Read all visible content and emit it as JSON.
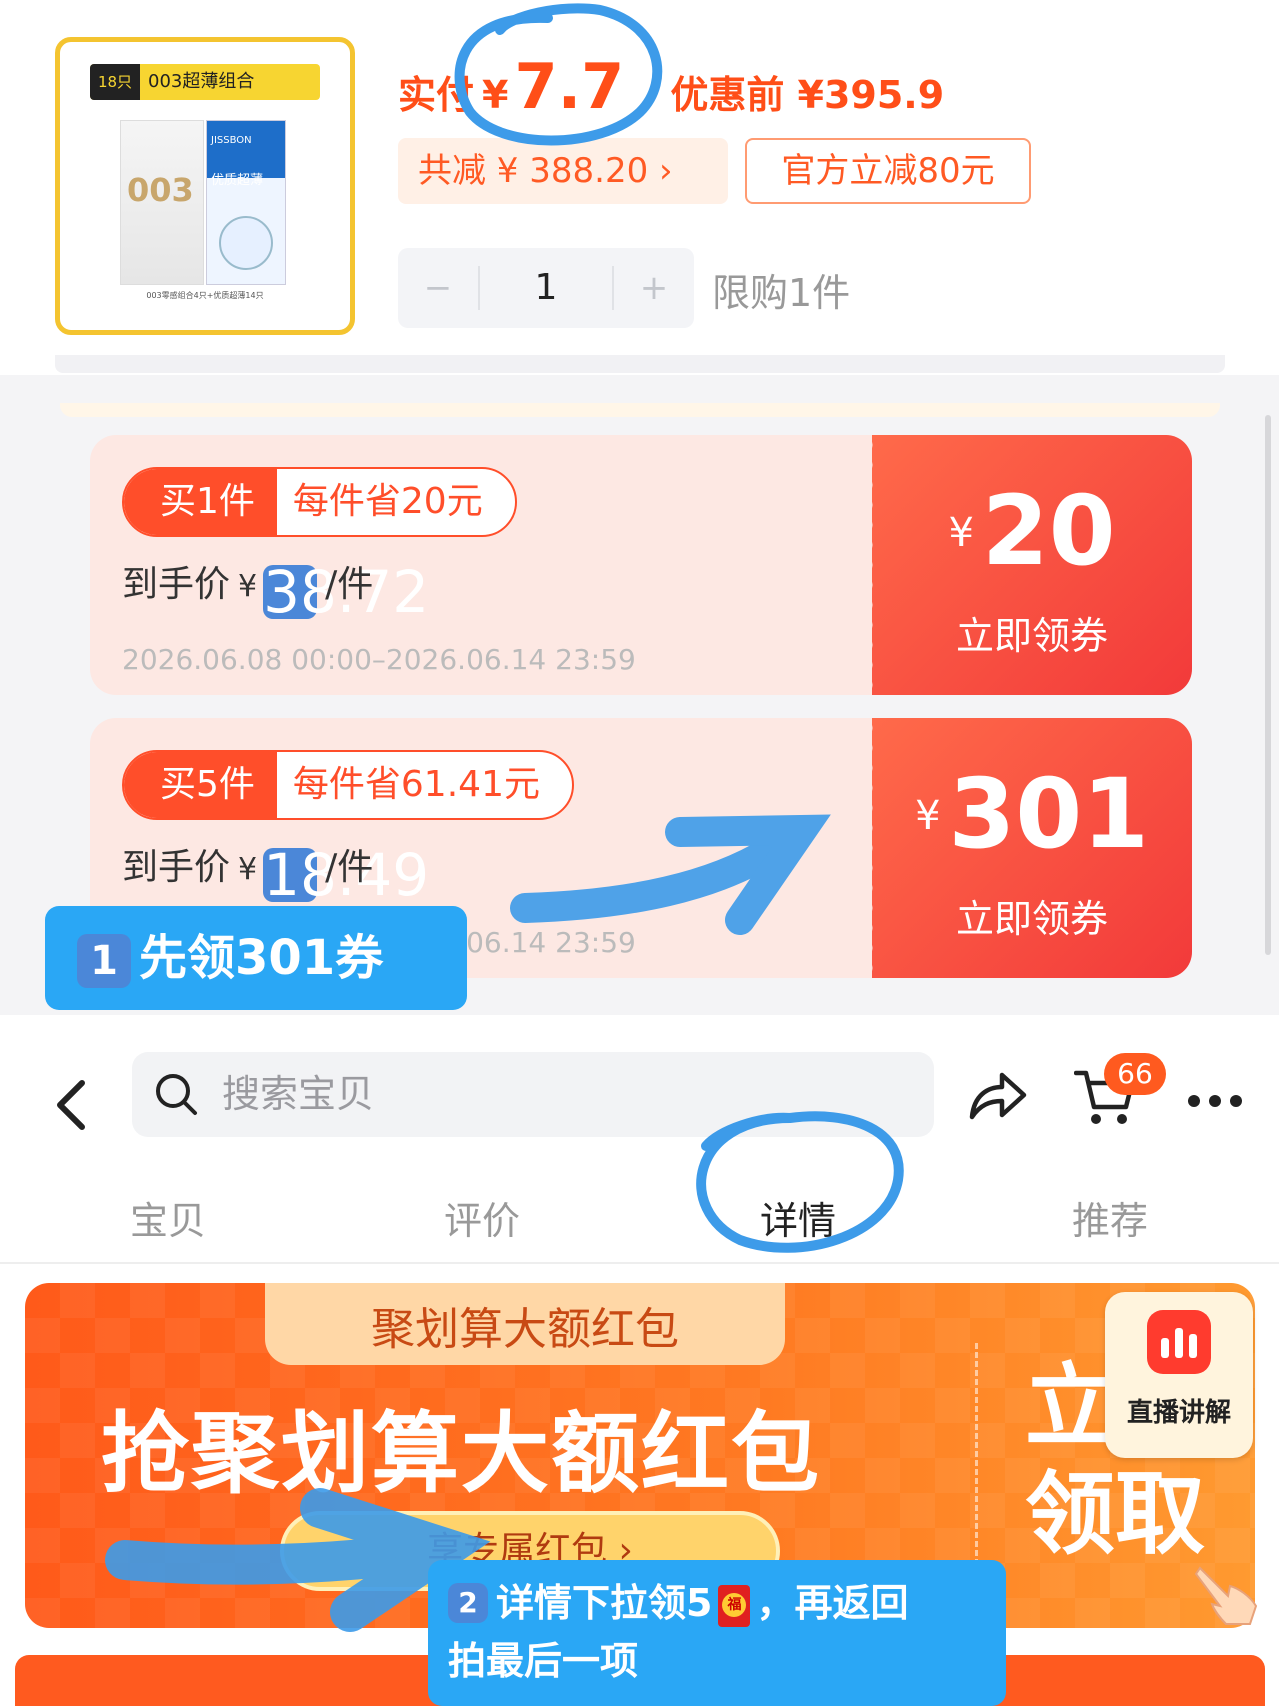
{
  "product": {
    "thumb_count_tag": "18只",
    "thumb_title": "003超薄组合",
    "thumb_box1_text": "003",
    "thumb_box2_brand": "JISSBON",
    "thumb_box2_name": "优质超薄",
    "thumb_caption": "003零感组合4只+优质超薄14只"
  },
  "price": {
    "label": "实付",
    "currency": "¥",
    "value": "7.7",
    "before": "优惠前 ¥395.9",
    "total_saving": "共减 ¥ 388.20 ›",
    "official_discount": "官方立减80元"
  },
  "stepper": {
    "minus": "−",
    "qty": "1",
    "plus": "+"
  },
  "limit": "限购1件",
  "coupons": [
    {
      "buy": "买1件",
      "save": "每件省20元",
      "deal_label": "到手价",
      "deal_currency": "¥",
      "deal_price": "38.72",
      "deal_unit": "/件",
      "period": "2026.06.08 00:00–2026.06.14 23:59",
      "amount_currency": "¥",
      "amount": "20",
      "claim": "立即领券"
    },
    {
      "buy": "买5件",
      "save": "每件省61.41元",
      "deal_label": "到手价",
      "deal_currency": "¥",
      "deal_price": "18.49",
      "deal_unit": "/件",
      "period": "2026.06.08 00:00–2026.06.14 23:59",
      "amount_currency": "¥",
      "amount": "301",
      "claim": "立即领券"
    }
  ],
  "nav": {
    "search_placeholder": "搜索宝贝",
    "cart_badge": "66",
    "tabs": [
      "宝贝",
      "评价",
      "详情",
      "推荐"
    ],
    "active_tab": "详情"
  },
  "banner": {
    "subtitle": "聚划算大额红包",
    "headline": "抢聚划算大额红包",
    "cta": "享专属红包 ›",
    "claim": "立即领取",
    "live_label": "直播讲解"
  },
  "annotations": {
    "step1_num": "1",
    "step1": "先领301券",
    "step2_num": "2",
    "step2_a": "详情下拉领5",
    "step2_b": "，再返回",
    "step2_c": "拍最后一项"
  },
  "colors": {
    "accent": "#ff4e18",
    "coupon_red": "#f23a3a",
    "annotation_blue": "#2aa7f5"
  }
}
